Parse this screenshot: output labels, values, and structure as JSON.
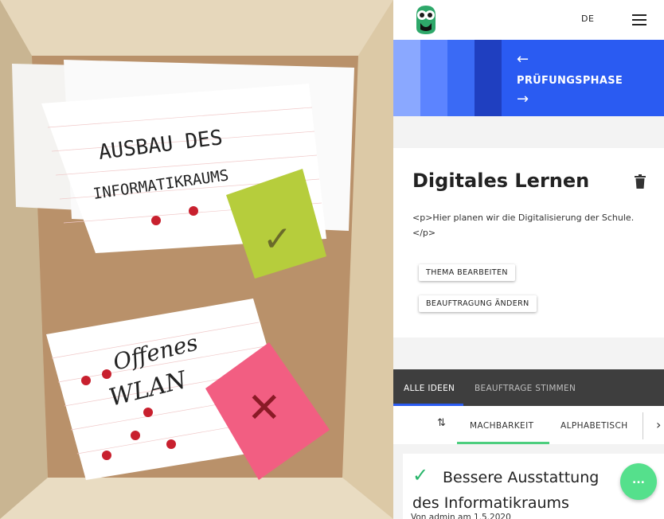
{
  "photo": {
    "card1_text_line1": "AUSBAU DES",
    "card1_text_line2": "INFORMATIKRAUMS",
    "card2_text_line1": "Offenes",
    "card2_text_line2": "WLAN",
    "note_check": "✓",
    "note_cross": "✕"
  },
  "header": {
    "language": "DE"
  },
  "phase": {
    "title": "PRÜFUNGSPHASE",
    "prev_arrow": "←",
    "next_arrow": "→",
    "colors": [
      "#8aa8ff",
      "#5c84ff",
      "#3a6af5",
      "#1f3fc0"
    ]
  },
  "topic": {
    "title": "Digitales Lernen",
    "description": "<p>Hier planen wir die Digitalisierung der Schule. </p>",
    "edit_button": "THEMA BEARBEITEN",
    "assign_button": "BEAUFTRAGUNG ÄNDERN"
  },
  "tabs": {
    "all_ideas": "ALLE IDEEN",
    "assigned_votes": "BEAUFTRAGE STIMMEN"
  },
  "sort": {
    "icon": "⇅",
    "feasibility": "MACHBARKEIT",
    "alphabetical": "ALPHABETISCH",
    "chevron": "›"
  },
  "idea": {
    "check": "✓",
    "title": "Bessere Ausstattung des Informatikraums",
    "meta": "Von admin am 1.5.2020"
  },
  "fab": {
    "label": "..."
  }
}
